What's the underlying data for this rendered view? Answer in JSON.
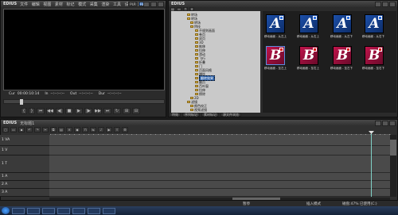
{
  "player": {
    "app_name": "EDIUS",
    "menu": [
      "文件",
      "编辑",
      "视图",
      "素材",
      "标记",
      "模式",
      "采集",
      "渲染",
      "工具",
      "设置",
      "帮助"
    ],
    "mode_labels": [
      "PLR",
      "REC"
    ],
    "timecodes": {
      "cur_label": "Cur",
      "cur": "00:00:10:14",
      "in_label": "In",
      "in": "--:--:--:--",
      "out_label": "Out",
      "out": "--:--:--:--",
      "dur_label": "Dur",
      "dur": "--:--:--:--"
    }
  },
  "effects": {
    "app_name": "EDIUS",
    "tree": [
      {
        "label": "转场",
        "level": 1
      },
      {
        "label": "转场",
        "level": 1
      },
      {
        "label": "转场",
        "level": 2
      },
      {
        "label": "特技",
        "level": 2
      },
      {
        "label": "不规则画面",
        "level": 3
      },
      {
        "label": "卷页",
        "level": 3
      },
      {
        "label": "双页",
        "level": 3
      },
      {
        "label": "3D",
        "level": 3
      },
      {
        "label": "推移",
        "level": 3
      },
      {
        "label": "拉伸",
        "level": 3
      },
      {
        "label": "滑动",
        "level": 3
      },
      {
        "label": "飞行",
        "level": 3
      },
      {
        "label": "折叠",
        "level": 3
      },
      {
        "label": "门",
        "level": 3
      },
      {
        "label": "页面风格",
        "level": 3
      },
      {
        "label": "爆炸",
        "level": 3
      },
      {
        "label": "翻转效果",
        "level": 3,
        "selected": true
      },
      {
        "label": "翻页",
        "level": 3
      },
      {
        "label": "百叶窗",
        "level": 3
      },
      {
        "label": "拉伸",
        "level": 3
      },
      {
        "label": "擦除",
        "level": 3
      },
      {
        "label": "2D",
        "level": 2
      },
      {
        "label": "滤镜",
        "level": 1
      },
      {
        "label": "颜色校正",
        "level": 2
      },
      {
        "label": "视频滤镜",
        "level": 2
      },
      {
        "label": "音频滤镜",
        "level": 2
      },
      {
        "label": "键",
        "level": 2
      }
    ],
    "thumbnails": [
      {
        "letter": "A",
        "color": "blue",
        "label": "移动画面 - 从左上"
      },
      {
        "letter": "A",
        "color": "blue",
        "label": "移动画面 - 从右上"
      },
      {
        "letter": "A",
        "color": "blue",
        "label": "移动画面 - 从左下"
      },
      {
        "letter": "A",
        "color": "blue",
        "label": "移动画面 - 从右下"
      },
      {
        "letter": "B",
        "color": "red",
        "label": "移动画面 - 至左上"
      },
      {
        "letter": "B",
        "color": "red",
        "label": "移动画面 - 至右上"
      },
      {
        "letter": "B",
        "color": "red",
        "label": "移动画面 - 至左下"
      },
      {
        "letter": "B",
        "color": "red",
        "label": "移动画面 - 至右下"
      }
    ],
    "bottom_tabs": [
      "特效",
      "序列标记",
      "素材标记",
      "源文件浏览"
    ]
  },
  "timeline": {
    "app_name": "EDIUS",
    "project": "无标题1",
    "tracks": [
      {
        "name": "1 VA"
      },
      {
        "name": "1 V"
      },
      {
        "name": "1 T"
      },
      {
        "name": "1 A"
      },
      {
        "name": "2 A"
      },
      {
        "name": "3 A"
      }
    ]
  },
  "status": {
    "left": "暂停",
    "mode": "插入模式",
    "disk": "磁盘:47% 已使用(C:)"
  },
  "colors": {
    "accent": "#2a5fa8",
    "thumb_blue": "#1c4fa8",
    "thumb_red": "#c0134a"
  }
}
